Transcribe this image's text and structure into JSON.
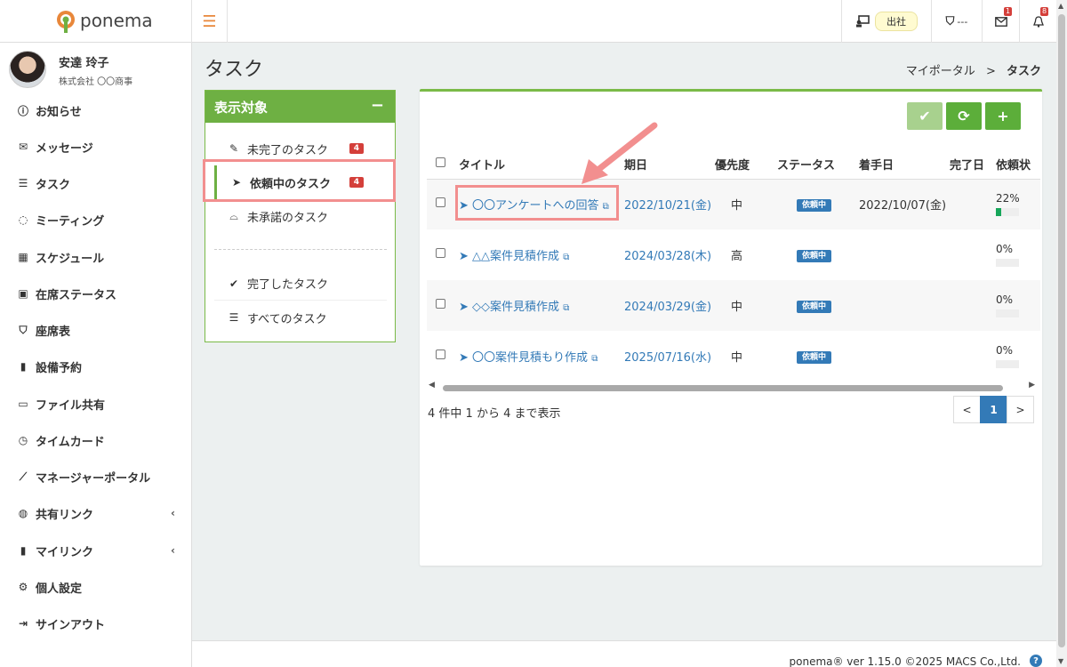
{
  "app": {
    "logo_text": "ponema"
  },
  "header": {
    "attendance_label": "出社",
    "seat_label": "---",
    "mail_count": "1",
    "notice_count": "8"
  },
  "user": {
    "name": "安達 玲子",
    "company": "株式会社 〇〇商事"
  },
  "sidebar": {
    "items": [
      {
        "label": "お知らせ",
        "icon": "info-icon"
      },
      {
        "label": "メッセージ",
        "icon": "envelope-icon"
      },
      {
        "label": "タスク",
        "icon": "task-list-icon"
      },
      {
        "label": "ミーティング",
        "icon": "chat-icon"
      },
      {
        "label": "スケジュール",
        "icon": "calendar-icon"
      },
      {
        "label": "在席ステータス",
        "icon": "presence-icon"
      },
      {
        "label": "座席表",
        "icon": "seat-icon"
      },
      {
        "label": "設備予約",
        "icon": "book-icon"
      },
      {
        "label": "ファイル共有",
        "icon": "folder-icon"
      },
      {
        "label": "タイムカード",
        "icon": "clock-icon"
      },
      {
        "label": "マネージャーポータル",
        "icon": "chart-icon"
      },
      {
        "label": "共有リンク",
        "icon": "globe-icon"
      },
      {
        "label": "マイリンク",
        "icon": "bookmark-icon"
      },
      {
        "label": "個人設定",
        "icon": "gear-icon"
      },
      {
        "label": "サインアウト",
        "icon": "sign-out-icon"
      }
    ]
  },
  "page": {
    "title": "タスク",
    "breadcrumb_parent": "マイポータル",
    "breadcrumb_sep": ">",
    "breadcrumb_current": "タスク"
  },
  "filter": {
    "header": "表示対象",
    "collapse": "−",
    "items": [
      {
        "label": "未完了のタスク",
        "count": "4"
      },
      {
        "label": "依頼中のタスク",
        "count": "4"
      },
      {
        "label": "未承諾のタスク"
      },
      {
        "label": "完了したタスク"
      },
      {
        "label": "すべてのタスク"
      }
    ]
  },
  "table": {
    "columns": [
      "タイトル",
      "期日",
      "優先度",
      "ステータス",
      "着手日",
      "完了日",
      "依頼状"
    ],
    "rows": [
      {
        "title": "〇〇アンケートへの回答",
        "due": "2022/10/21(金)",
        "priority": "中",
        "status": "依頼中",
        "start": "2022/10/07(金)",
        "done": "",
        "progress": "22%",
        "progress_value": 0.22
      },
      {
        "title": "△△案件見積作成",
        "due": "2024/03/28(木)",
        "priority": "高",
        "status": "依頼中",
        "start": "",
        "done": "",
        "progress": "0%",
        "progress_value": 0
      },
      {
        "title": "◇◇案件見積作成",
        "due": "2024/03/29(金)",
        "priority": "中",
        "status": "依頼中",
        "start": "",
        "done": "",
        "progress": "0%",
        "progress_value": 0
      },
      {
        "title": "〇〇案件見積もり作成",
        "due": "2025/07/16(水)",
        "priority": "中",
        "status": "依頼中",
        "start": "",
        "done": "",
        "progress": "0%",
        "progress_value": 0
      }
    ],
    "info": "4 件中 1 から 4 まで表示",
    "pager": {
      "prev": "<",
      "current": "1",
      "next": ">"
    }
  },
  "footer": {
    "text": "ponema® ver 1.15.0 ©2025 MACS Co.,Ltd.",
    "help": "?"
  },
  "colors": {
    "accent_green": "#6eb043",
    "link_blue": "#337ab7",
    "badge_red": "#d43f3a",
    "highlight_pink": "#f28f8f"
  }
}
